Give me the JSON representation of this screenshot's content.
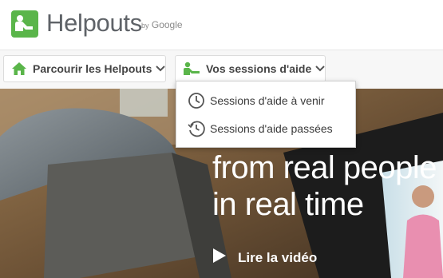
{
  "header": {
    "brand": "Helpouts",
    "byline_by": "by",
    "byline_google": "Google"
  },
  "nav": {
    "browse_label": "Parcourir les Helpouts",
    "sessions_label": "Vos sessions d'aide"
  },
  "dropdown": {
    "items": [
      {
        "label": "Sessions d'aide à venir",
        "icon": "clock-icon"
      },
      {
        "label": "Sessions d'aide passées",
        "icon": "history-icon"
      }
    ]
  },
  "hero": {
    "headline_line1": "from real people",
    "headline_line2": "in real time",
    "play_label": "Lire la vidéo"
  },
  "colors": {
    "brand_green": "#5ab54a",
    "text_gray": "#5f6368"
  }
}
